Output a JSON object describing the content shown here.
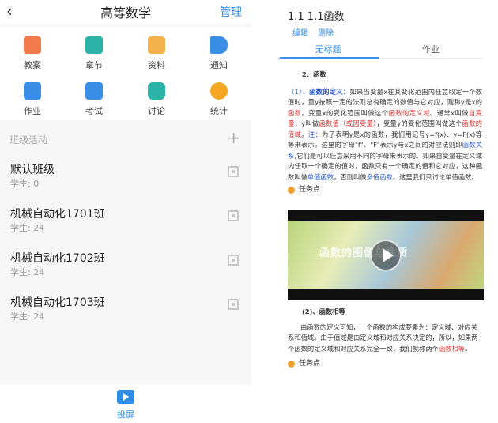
{
  "left": {
    "header": {
      "back": "‹",
      "title": "高等数学",
      "manage": "管理"
    },
    "grid": [
      {
        "label": "教案",
        "icon": "ppt-icon",
        "color": "#f07a4a"
      },
      {
        "label": "章节",
        "icon": "list-icon",
        "color": "#2ab3a6"
      },
      {
        "label": "资料",
        "icon": "folder-icon",
        "color": "#f5b14c"
      },
      {
        "label": "通知",
        "icon": "speaker-icon",
        "color": "#3a8ee6"
      },
      {
        "label": "作业",
        "icon": "homework-icon",
        "color": "#3a8ee6"
      },
      {
        "label": "考试",
        "icon": "exam-icon",
        "color": "#3a8ee6"
      },
      {
        "label": "讨论",
        "icon": "chat-icon",
        "color": "#2ab3a6"
      },
      {
        "label": "统计",
        "icon": "pie-chart-icon",
        "color": "#f5a623"
      }
    ],
    "section": {
      "title": "班级活动",
      "plus": "+"
    },
    "classes": [
      {
        "name": "默认班级",
        "students": "学生: 0"
      },
      {
        "name": "机械自动化1701班",
        "students": "学生: 24"
      },
      {
        "name": "机械自动化1702班",
        "students": "学生: 24"
      },
      {
        "name": "机械自动化1703班",
        "students": "学生: 24"
      }
    ],
    "bottom": {
      "label": "投屏"
    }
  },
  "right": {
    "title": "1.1 1.1函数",
    "actions": {
      "edit": "编辑",
      "delete": "删除"
    },
    "tabs": {
      "untitled": "无标题",
      "homework": "作业"
    },
    "heading": "2、函数",
    "para1": {
      "a": "（1）、",
      "b": "函数的定义：",
      "c": "如果当变量x在其变化范围内任意取定一个数值时，量y按照一定的法则总有确定的数值与它对应，则称y是x的",
      "d": "函数",
      "e": "。变量x的变化范围叫做这个",
      "f": "函数的定义域",
      "g": "。通常x叫做",
      "h": "自变量",
      "i": "，y叫做",
      "j": "函数值（或因变量）",
      "k": "，变量y的变化范围叫做这个",
      "l": "函数的值域",
      "m": "。",
      "n": "注：",
      "o": "为了表明y是x的函数，我们用记号y=f(x)、y=F(x)等等来表示。这里的字母\"f\"、\"F\"表示y与x之间的对应法则即",
      "p": "函数关系",
      "q": ",它们是可以任意采用不同的字母来表示的。如果自变量在定义域内任取一个确定的值时，函数只有一个确定的值和它对应，这种函数叫做",
      "r": "单值函数",
      "s": "，否则叫做",
      "t": "多值函数",
      "u": "。这里我们只讨论单值函数。"
    },
    "task1": "任务点",
    "video_text": "函数的图像与性质",
    "heading2": "(2)、函数相等",
    "para2": {
      "a": "由函数的定义可知，一个函数的构成要素为：定义域、对应关系和值域。由于值域是由定义域和对应关系决定的，所以，如果两个函数的定义域和对应关系完全一致，我们就称两个",
      "b": "函数相等",
      "c": "。"
    },
    "task2": "任务点"
  }
}
